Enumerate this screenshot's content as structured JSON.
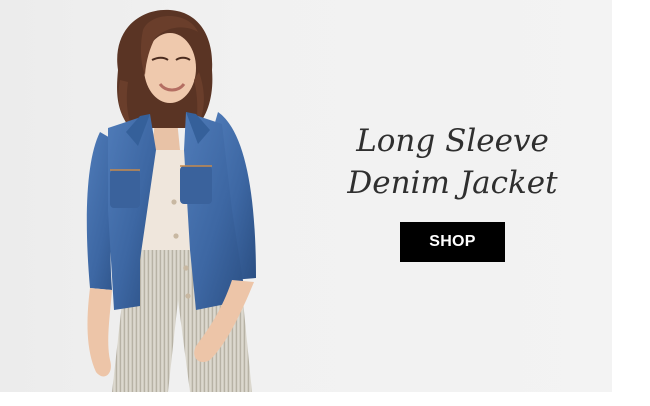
{
  "promo": {
    "headline_line1": "Long Sleeve",
    "headline_line2": "Denim Jacket",
    "cta_label": "SHOP",
    "image_subject": "model wearing denim jacket"
  },
  "colors": {
    "background": "#f1f1f1",
    "headline_text": "#2f2f2f",
    "cta_background": "#000000",
    "cta_text": "#ffffff",
    "denim": "#3d67a3"
  }
}
